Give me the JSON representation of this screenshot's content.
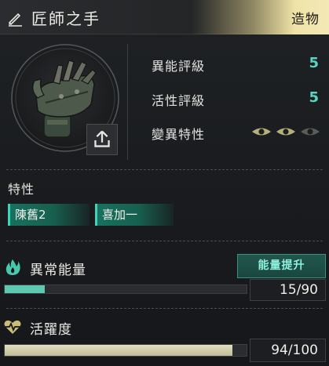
{
  "header": {
    "title": "匠師之手",
    "badge": "造物"
  },
  "item": {
    "image": "mechanical-hand-item"
  },
  "stats": [
    {
      "label": "異能評級",
      "value": "5"
    },
    {
      "label": "活性評級",
      "value": "5"
    },
    {
      "label": "變異特性",
      "eyes_active": 2,
      "eyes_total": 3
    }
  ],
  "traits": {
    "heading": "特性",
    "items": [
      "陳舊2",
      "喜加一"
    ]
  },
  "energy": {
    "label": "異常能量",
    "button": "能量提升",
    "current": 15,
    "max": 90,
    "text": "15/90",
    "fill": 0.1667
  },
  "vitality": {
    "label": "活躍度",
    "current": 94,
    "max": 100,
    "text": "94/100",
    "fill": 0.94
  },
  "colors": {
    "accent": "#55d6c2",
    "badge": "#efe3a8",
    "energy_fill": "#5fc8b0",
    "vitality_fill": "#cfcdb0"
  },
  "icons": [
    "pencil-icon",
    "share-icon",
    "eye-icon",
    "flame-icon",
    "heart-pulse-icon"
  ]
}
